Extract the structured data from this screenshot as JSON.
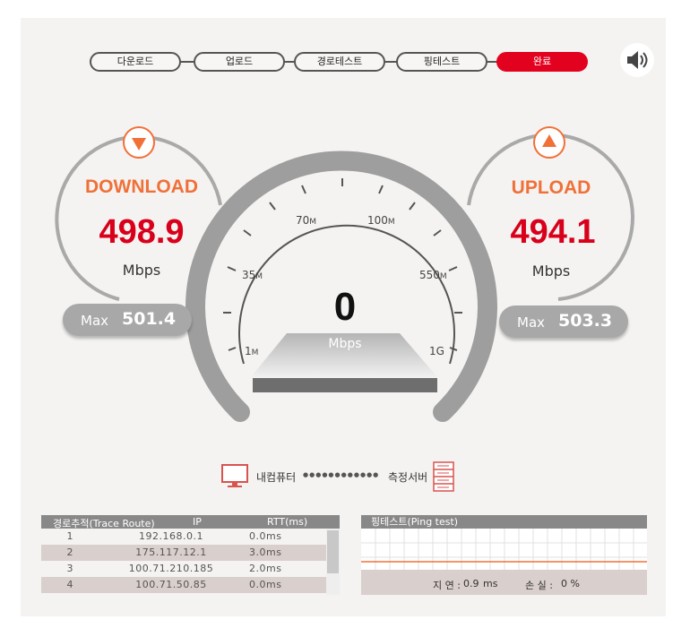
{
  "steps": [
    {
      "label": "다운로드",
      "active": false
    },
    {
      "label": "업로드",
      "active": false
    },
    {
      "label": "경로테스트",
      "active": false
    },
    {
      "label": "핑테스트",
      "active": false
    },
    {
      "label": "완료",
      "active": true
    }
  ],
  "sound_icon": "speaker-icon",
  "download": {
    "title": "DOWNLOAD",
    "value": "498.9",
    "unit": "Mbps",
    "max_label": "Max",
    "max_value": "501.4"
  },
  "upload": {
    "title": "UPLOAD",
    "value": "494.1",
    "unit": "Mbps",
    "max_label": "Max",
    "max_value": "503.3"
  },
  "gauge": {
    "value": "0",
    "unit": "Mbps",
    "labels": [
      {
        "num": "1",
        "suf": "M"
      },
      {
        "num": "35",
        "suf": "M"
      },
      {
        "num": "70",
        "suf": "M"
      },
      {
        "num": "100",
        "suf": "M"
      },
      {
        "num": "550",
        "suf": "M"
      },
      {
        "num": "1G",
        "suf": ""
      }
    ]
  },
  "connection": {
    "left_label": "내컴퓨터",
    "dots": "●●●●●●●●●●●●",
    "right_label": "측정서버"
  },
  "trace": {
    "headers": [
      "경로추적(Trace Route)",
      "IP",
      "RTT(ms)"
    ],
    "rows": [
      {
        "n": "1",
        "ip": "192.168.0.1",
        "rtt": "0.0ms"
      },
      {
        "n": "2",
        "ip": "175.117.12.1",
        "rtt": "3.0ms"
      },
      {
        "n": "3",
        "ip": "100.71.210.185",
        "rtt": "2.0ms"
      },
      {
        "n": "4",
        "ip": "100.71.50.85",
        "rtt": "0.0ms"
      }
    ]
  },
  "ping": {
    "title": "핑테스트(Ping test)",
    "latency_label": "지 연 :",
    "latency_value": "0.9",
    "latency_unit": "ms",
    "loss_label": "손 실 :",
    "loss_value": "0 %"
  },
  "colors": {
    "accent": "#e2021f",
    "orange": "#f07038",
    "value_red": "#d9001b"
  }
}
